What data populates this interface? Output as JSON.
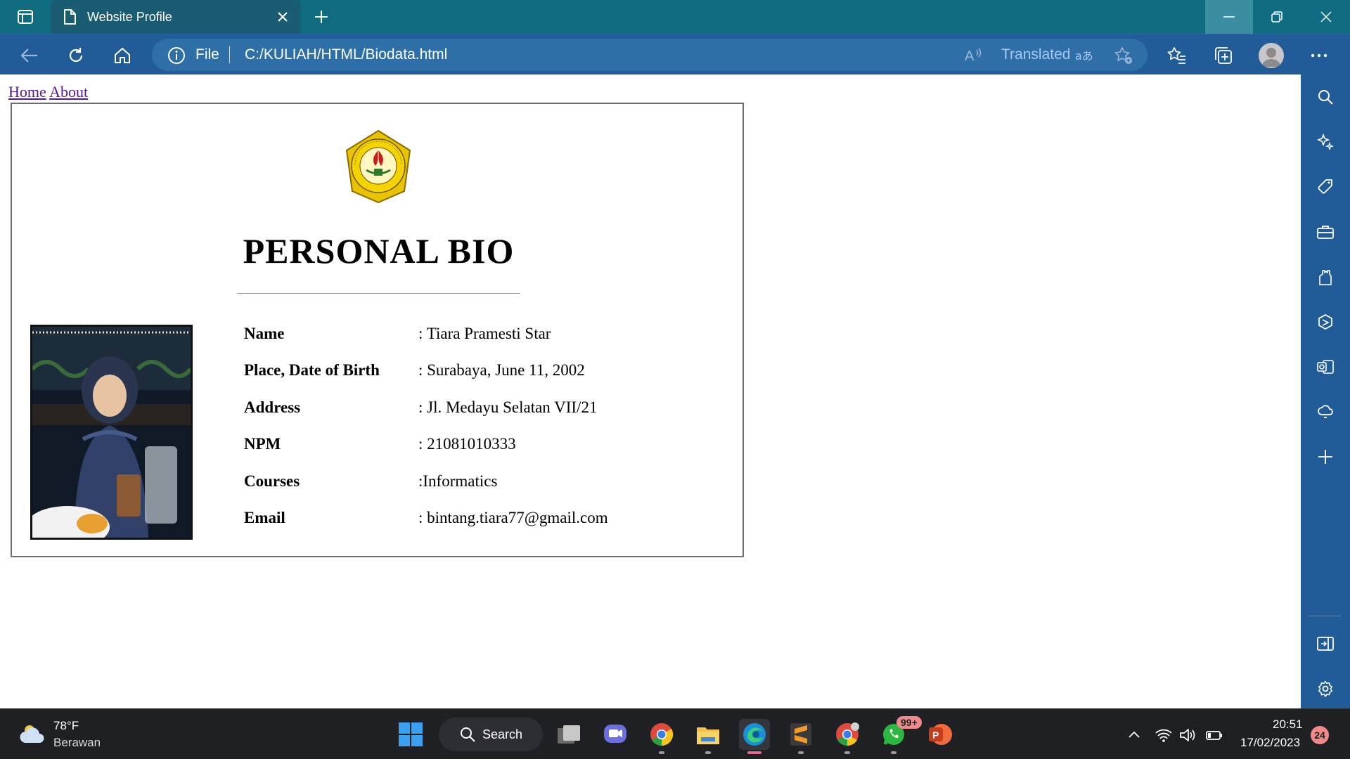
{
  "browser": {
    "tab_title": "Website Profile",
    "address": {
      "scheme_label": "File",
      "url": "C:/KULIAH/HTML/Biodata.html",
      "translated_label": "Translated"
    }
  },
  "page": {
    "nav": [
      {
        "label": "Home"
      },
      {
        "label": "About"
      }
    ],
    "title": "PERSONAL BIO",
    "bio": [
      {
        "label": "Name",
        "value": ": Tiara Pramesti Star"
      },
      {
        "label": "Place, Date of Birth",
        "value": ": Surabaya, June 11, 2002"
      },
      {
        "label": "Address",
        "value": ": Jl. Medayu Selatan VII/21"
      },
      {
        "label": "NPM",
        "value": ": 21081010333"
      },
      {
        "label": "Courses",
        "value": ":Informatics"
      },
      {
        "label": "Email",
        "value": ": bintang.tiara77@gmail.com"
      }
    ],
    "logo_text": "UNIVERSITAS PEMBANGUNAN NASIONAL VETERAN JAWA TIMUR"
  },
  "taskbar": {
    "weather_temp": "78°F",
    "weather_desc": "Berawan",
    "search_label": "Search",
    "whatsapp_badge": "99+",
    "clock_time": "20:51",
    "clock_date": "17/02/2023",
    "notification_count": "24"
  },
  "colors": {
    "titlebar": "#0f6b7f",
    "toolbar": "#215c99",
    "link_visited": "#551a8b",
    "taskbar": "#1f2024"
  }
}
